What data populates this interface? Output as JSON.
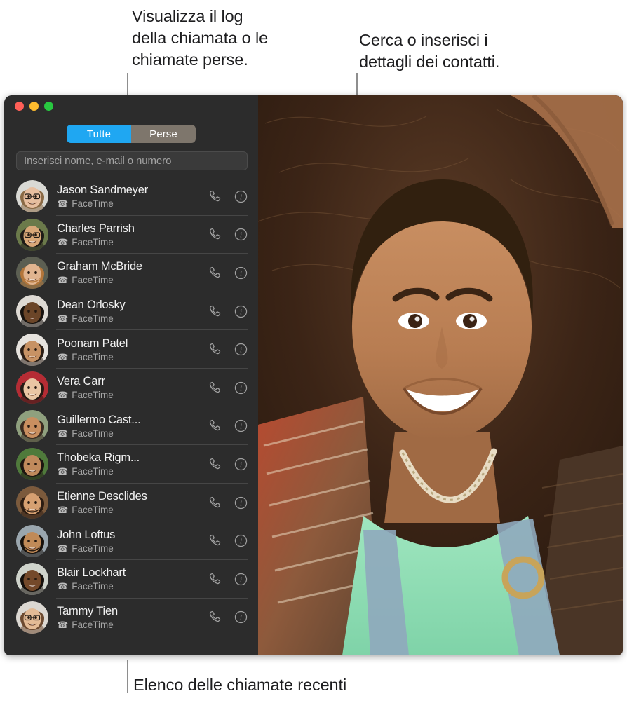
{
  "callouts": {
    "log": "Visualizza il log\ndella chiamata o le\nchiamate perse.",
    "search": "Cerca o inserisci i\ndettagli dei contatti.",
    "bottom": "Elenco delle chiamate recenti"
  },
  "window": {
    "traffic_lights": [
      {
        "name": "close",
        "color": "#ff5f57"
      },
      {
        "name": "minimize",
        "color": "#febc2e"
      },
      {
        "name": "zoom",
        "color": "#28c840"
      }
    ],
    "segmented_control": {
      "options": [
        "Tutte",
        "Perse"
      ],
      "selected": "Tutte",
      "active_color": "#1fa7f2",
      "inactive_color": "#7e766c"
    },
    "search": {
      "value": "",
      "placeholder": "Inserisci nome, e-mail o numero"
    },
    "row_actions": {
      "call_icon": "phone-handset-icon",
      "info_icon": "info-circle-icon"
    },
    "contacts": [
      {
        "name": "Jason Sandmeyer",
        "service": "FaceTime",
        "avatar_skin": "#e7bfa0",
        "avatar_hair": "#8a6a45",
        "avatar_bg": "#d9d9d4",
        "glasses": true,
        "beard": false
      },
      {
        "name": "Charles Parrish",
        "service": "FaceTime",
        "avatar_skin": "#d9a878",
        "avatar_hair": "#1e1a16",
        "avatar_bg": "#6b7a4a",
        "glasses": true,
        "beard": false
      },
      {
        "name": "Graham McBride",
        "service": "FaceTime",
        "avatar_skin": "#e0b48f",
        "avatar_hair": "#b4763a",
        "avatar_bg": "#5c5f52",
        "glasses": false,
        "beard": true
      },
      {
        "name": "Dean Orlosky",
        "service": "FaceTime",
        "avatar_skin": "#6b4528",
        "avatar_hair": "#17120e",
        "avatar_bg": "#dedad4",
        "glasses": false,
        "beard": false
      },
      {
        "name": "Poonam Patel",
        "service": "FaceTime",
        "avatar_skin": "#c79264",
        "avatar_hair": "#2a1d14",
        "avatar_bg": "#e6e3de",
        "glasses": false,
        "beard": false
      },
      {
        "name": "Vera Carr",
        "service": "FaceTime",
        "avatar_skin": "#eac6a4",
        "avatar_hair": "#241a14",
        "avatar_bg": "#b52c34",
        "glasses": false,
        "beard": false
      },
      {
        "name": "Guillermo Cast...",
        "service": "FaceTime",
        "avatar_skin": "#c98f60",
        "avatar_hair": "#3a2b20",
        "avatar_bg": "#8fa07e",
        "glasses": false,
        "beard": false
      },
      {
        "name": "Thobeka Rigm...",
        "service": "FaceTime",
        "avatar_skin": "#c08a5c",
        "avatar_hair": "#1d1510",
        "avatar_bg": "#4f7a3b",
        "glasses": false,
        "beard": false
      },
      {
        "name": "Etienne Desclides",
        "service": "FaceTime",
        "avatar_skin": "#d6a071",
        "avatar_hair": "#2b1c12",
        "avatar_bg": "#7b5a3c",
        "glasses": false,
        "beard": true
      },
      {
        "name": "John Loftus",
        "service": "FaceTime",
        "avatar_skin": "#c08a58",
        "avatar_hair": "#17110c",
        "avatar_bg": "#9aa6ae",
        "glasses": false,
        "beard": true
      },
      {
        "name": "Blair Lockhart",
        "service": "FaceTime",
        "avatar_skin": "#74492a",
        "avatar_hair": "#140f0b",
        "avatar_bg": "#cfd3cb",
        "glasses": false,
        "beard": false
      },
      {
        "name": "Tammy Tien",
        "service": "FaceTime",
        "avatar_skin": "#e3bb96",
        "avatar_hair": "#6d4a30",
        "avatar_bg": "#dcd8d2",
        "glasses": true,
        "beard": false
      }
    ]
  }
}
